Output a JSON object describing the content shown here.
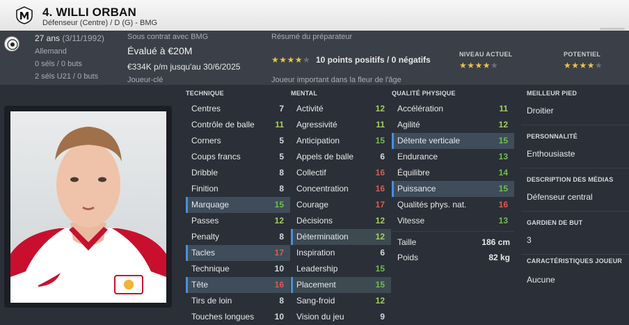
{
  "header": {
    "name": "4. WILLI ORBAN",
    "subtitle": "Défenseur (Centre) / D (G) - BMG",
    "club_badge_icon": "club-crest-icon"
  },
  "info": {
    "age": "27 ans",
    "dob": "(3/11/1992)",
    "nationality": "Allemand",
    "caps": "0 séls / 0 buts",
    "caps_u21": "2 séls U21 / 0 buts",
    "contract_label": "Sous contrat avec BMG",
    "value": "Évalué à €20M",
    "wage": "€334K p/m jusqu'au 30/6/2025",
    "role": "Joueur-clé",
    "report_label": "Résumé du préparateur",
    "report_summary": "10 points positifs / 0 négatifs",
    "report_stars": 4,
    "report_note": "Joueur important dans la fleur de l'âge",
    "current_ability_label": "NIVEAU ACTUEL",
    "current_ability_stars": 4,
    "potential_label": "POTENTIEL",
    "potential_stars": 4
  },
  "columns": {
    "technique": {
      "title": "TECHNIQUE",
      "attrs": [
        {
          "name": "Centres",
          "value": "7"
        },
        {
          "name": "Contrôle de balle",
          "value": "11"
        },
        {
          "name": "Corners",
          "value": "5"
        },
        {
          "name": "Coups francs",
          "value": "5"
        },
        {
          "name": "Dribble",
          "value": "8"
        },
        {
          "name": "Finition",
          "value": "8"
        },
        {
          "name": "Marquage",
          "value": "15"
        },
        {
          "name": "Passes",
          "value": "12"
        },
        {
          "name": "Penalty",
          "value": "8"
        },
        {
          "name": "Tacles",
          "value": "17"
        },
        {
          "name": "Technique",
          "value": "10"
        },
        {
          "name": "Tête",
          "value": "16"
        },
        {
          "name": "Tirs de loin",
          "value": "8"
        },
        {
          "name": "Touches longues",
          "value": "10"
        }
      ]
    },
    "mental": {
      "title": "MENTAL",
      "attrs": [
        {
          "name": "Activité",
          "value": "12"
        },
        {
          "name": "Agressivité",
          "value": "11"
        },
        {
          "name": "Anticipation",
          "value": "15"
        },
        {
          "name": "Appels de balle",
          "value": "6"
        },
        {
          "name": "Collectif",
          "value": "16"
        },
        {
          "name": "Concentration",
          "value": "16"
        },
        {
          "name": "Courage",
          "value": "17"
        },
        {
          "name": "Décisions",
          "value": "12"
        },
        {
          "name": "Détermination",
          "value": "12"
        },
        {
          "name": "Inspiration",
          "value": "6"
        },
        {
          "name": "Leadership",
          "value": "15"
        },
        {
          "name": "Placement",
          "value": "15"
        },
        {
          "name": "Sang-froid",
          "value": "12"
        },
        {
          "name": "Vision du jeu",
          "value": "9"
        }
      ]
    },
    "physical": {
      "title": "QUALITÉ PHYSIQUE",
      "attrs": [
        {
          "name": "Accélération",
          "value": "11"
        },
        {
          "name": "Agilité",
          "value": "12"
        },
        {
          "name": "Détente verticale",
          "value": "15"
        },
        {
          "name": "Endurance",
          "value": "13"
        },
        {
          "name": "Équilibre",
          "value": "14"
        },
        {
          "name": "Puissance",
          "value": "15"
        },
        {
          "name": "Qualités phys. nat.",
          "value": "16"
        },
        {
          "name": "Vitesse",
          "value": "13"
        }
      ],
      "height_label": "Taille",
      "height_value": "186 cm",
      "weight_label": "Poids",
      "weight_value": "82 kg"
    }
  },
  "side": {
    "foot_label": "MEILLEUR PIED",
    "foot_value": "Droitier",
    "personality_label": "PERSONNALITÉ",
    "personality_value": "Enthousiaste",
    "media_label": "DESCRIPTION DES MÉDIAS",
    "media_value": "Défenseur central",
    "gk_label": "GARDIEN DE BUT",
    "gk_value": "3",
    "traits_label": "CARACTÉRISTIQUES JOUEUR",
    "traits_value": "Aucune"
  },
  "colors": {
    "good": "#6fbf4e",
    "poor": "#e05a4e",
    "highlight_bar": "#4b8fd6",
    "star": "#e8c34a"
  }
}
